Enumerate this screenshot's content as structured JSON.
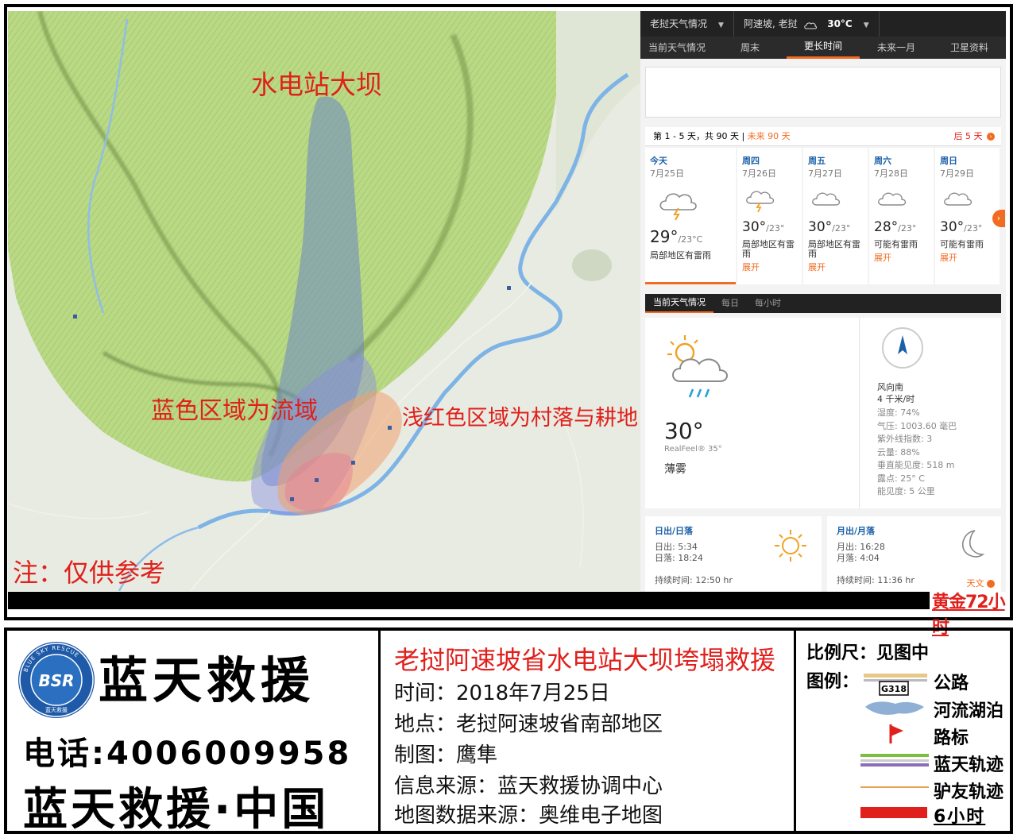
{
  "map": {
    "labels": {
      "dam": "水电站大坝",
      "basin": "蓝色区域为流域",
      "village": "浅红色区域为村落与耕地",
      "note": "注：仅供参考"
    },
    "banner_right": "黄金72小时"
  },
  "weather": {
    "location_select": "老挝天气情况",
    "current_location": "阿速坡, 老挝",
    "current_temp": "30°C",
    "tabs": [
      "当前天气情况",
      "周末",
      "更长时间",
      "未来一月",
      "卫星资料"
    ],
    "active_tab": "更长时间",
    "forecast_header": {
      "range": "第 1 - 5 天，共 90 天",
      "sep": " | ",
      "future": "未来 90 天",
      "next": "后 5 天"
    },
    "days": [
      {
        "name": "今天",
        "date": "7月25日",
        "high": "29°",
        "low": "/23°C",
        "desc": "局部地区有雷雨",
        "more": ""
      },
      {
        "name": "周四",
        "date": "7月26日",
        "high": "30°",
        "low": "/23°",
        "desc": "局部地区有雷雨",
        "more": "展开"
      },
      {
        "name": "周五",
        "date": "7月27日",
        "high": "30°",
        "low": "/23°",
        "desc": "局部地区有雷雨",
        "more": "展开"
      },
      {
        "name": "周六",
        "date": "7月28日",
        "high": "28°",
        "low": "/23°",
        "desc": "可能有雷雨",
        "more": "展开"
      },
      {
        "name": "周日",
        "date": "7月29日",
        "high": "30°",
        "low": "/23°",
        "desc": "可能有雷雨",
        "more": "展开"
      }
    ],
    "current_tabs": [
      "当前天气情况",
      "每日",
      "每小时"
    ],
    "current": {
      "temp": "30°",
      "realfeel": "RealFeel® 35°",
      "phrase": "薄雾",
      "wind_dir": "风向南",
      "wind_speed": "4 千米/时",
      "stats": [
        "湿度: 74%",
        "气压: 1003.60 毫巴",
        "紫外线指数: 3",
        "云量: 88%",
        "垂直能见度: 518 m",
        "露点: 25° C",
        "能见度: 5 公里"
      ]
    },
    "sun": {
      "title": "日出/日落",
      "rise": "日出: 5:34",
      "set": "日落: 18:24",
      "duration": "持续时间: 12:50 hr"
    },
    "moon": {
      "title": "月出/月落",
      "rise": "月出: 16:28",
      "set": "月落: 4:04",
      "duration": "持续时间: 11:36 hr",
      "link": "天文"
    }
  },
  "info": {
    "logo_ring_text": "BLUE SKY RESCUE",
    "logo_text": "BSR",
    "logo_bottom_text": "蓝天救援",
    "org_name": "蓝天救援",
    "phone": "电话:4006009958",
    "org_china": "蓝天救援·中国",
    "event_title": "老挝阿速坡省水电站大坝垮塌救援",
    "time": "时间：2018年7月25日",
    "place": "地点：老挝阿速坡省南部地区",
    "author": "制图：鹰隼",
    "source": "信息来源：蓝天救援协调中心",
    "map_source": "地图数据来源：奥维电子地图",
    "scale": "比例尺：见图中",
    "legend_title": "图例：",
    "road_code": "G318",
    "legend": [
      "公路",
      "河流湖泊",
      "路标",
      "蓝天轨迹",
      "驴友轨迹",
      "6小时"
    ]
  },
  "colors": {
    "label_red": "#e0201c",
    "accent_orange": "#f26b22",
    "terrain_green": "#b3d67a",
    "basin_blue": "#6a86c4",
    "village_pink": "#f0a090",
    "river": "#6fa8e0"
  }
}
